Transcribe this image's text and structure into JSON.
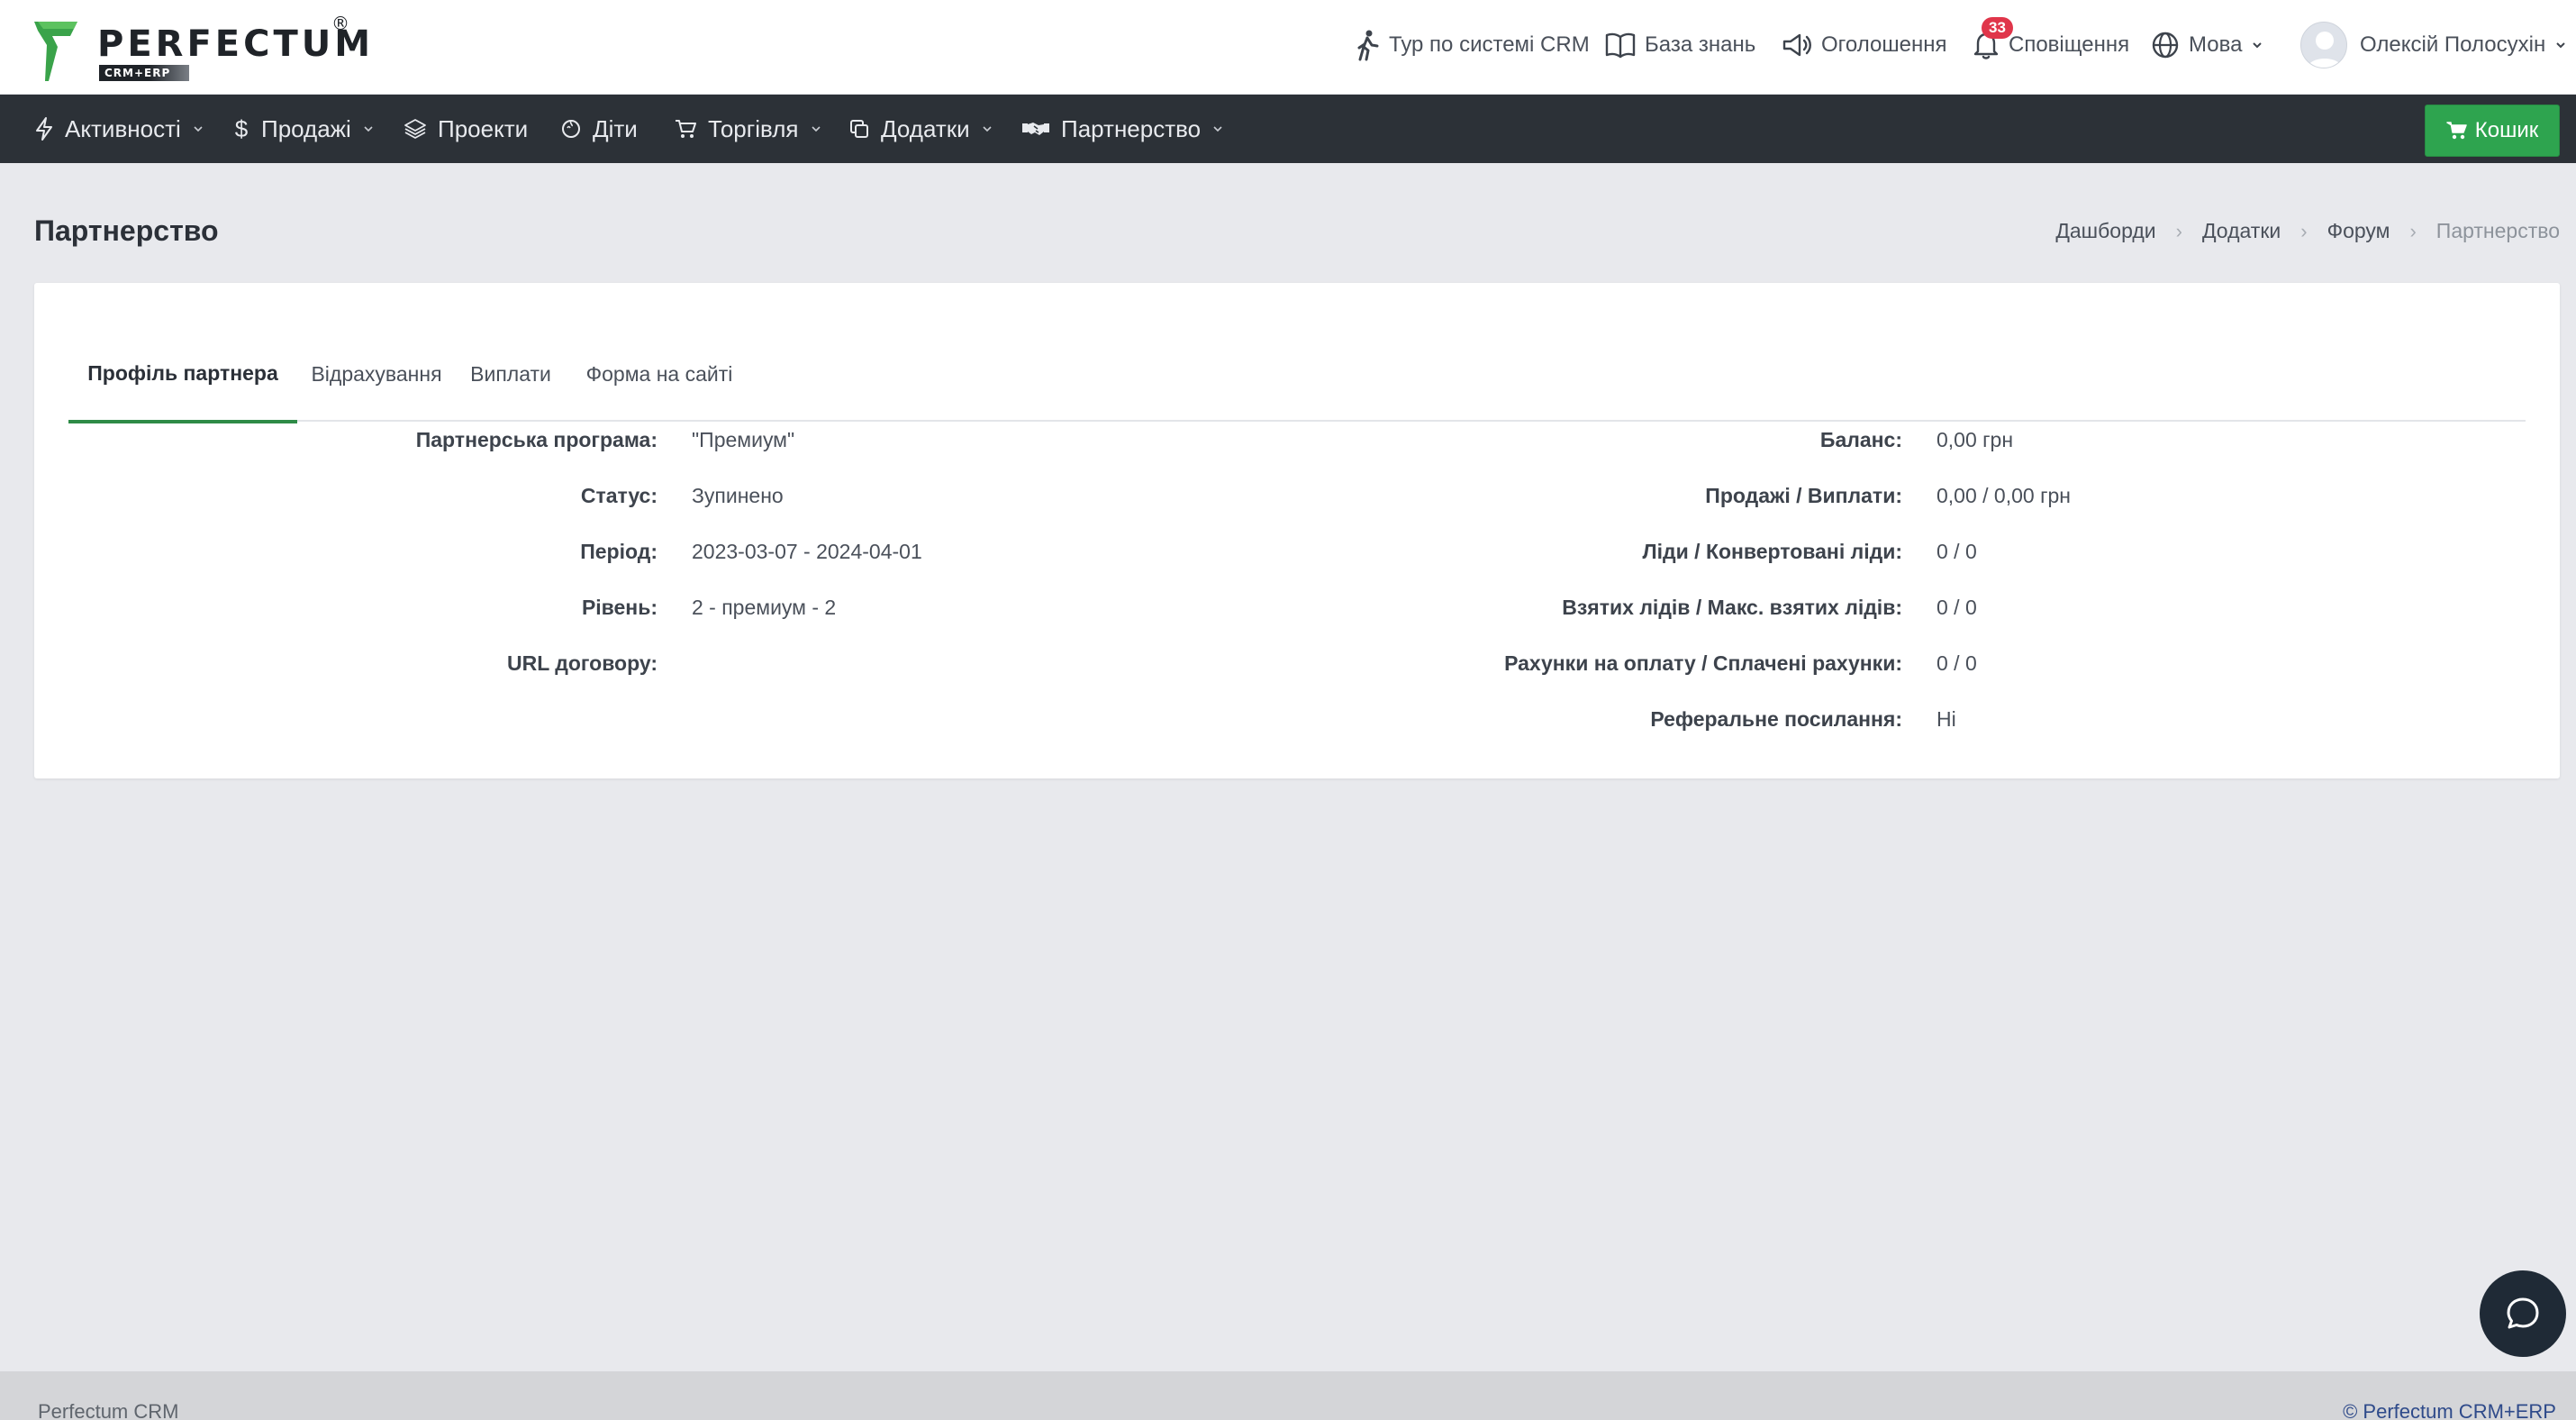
{
  "brand": {
    "name": "PERFECTUM",
    "sub": "CRM+ERP",
    "reg_mark": "®",
    "accent_color": "#2ea44f"
  },
  "topnav": {
    "tour": "Тур по системі CRM",
    "knowledge": "База знань",
    "announcements": "Оголошення",
    "notifications": "Сповіщення",
    "notifications_count": "33",
    "language": "Мова",
    "user": "Олексій Полосухін"
  },
  "mainnav": {
    "activities": "Активності",
    "sales": "Продажі",
    "projects": "Проекти",
    "kids": "Діти",
    "trade": "Торгівля",
    "addons": "Додатки",
    "partnership": "Партнерство",
    "cart": "Кошик"
  },
  "page": {
    "title": "Партнерство",
    "breadcrumb": [
      "Дашборди",
      "Додатки",
      "Форум",
      "Партнерство"
    ],
    "breadcrumb_sep": "›"
  },
  "tabs": [
    "Профіль партнера",
    "Відрахування",
    "Виплати",
    "Форма на сайті"
  ],
  "profile": {
    "left": [
      {
        "label": "Партнерська програма:",
        "value": "\"Премиум\""
      },
      {
        "label": "Статус:",
        "value": "Зупинено"
      },
      {
        "label": "Період:",
        "value": "2023-03-07 - 2024-04-01"
      },
      {
        "label": "Рівень:",
        "value": "2 - премиум - 2"
      },
      {
        "label": "URL договору:",
        "value": ""
      }
    ],
    "right": [
      {
        "label": "Баланс:",
        "value": "0,00 грн"
      },
      {
        "label": "Продажі / Виплати:",
        "value": "0,00 / 0,00 грн"
      },
      {
        "label": "Ліди / Конвертовані ліди:",
        "value": "0 / 0"
      },
      {
        "label": "Взятих лідів / Макс. взятих лідів:",
        "value": "0 / 0"
      },
      {
        "label": "Рахунки на оплату / Сплачені рахунки:",
        "value": "0 / 0"
      },
      {
        "label": "Реферальне посилання:",
        "value": "Ні"
      }
    ]
  },
  "footer": {
    "left": "Perfectum CRM",
    "right": "© Perfectum CRM+ERP"
  }
}
